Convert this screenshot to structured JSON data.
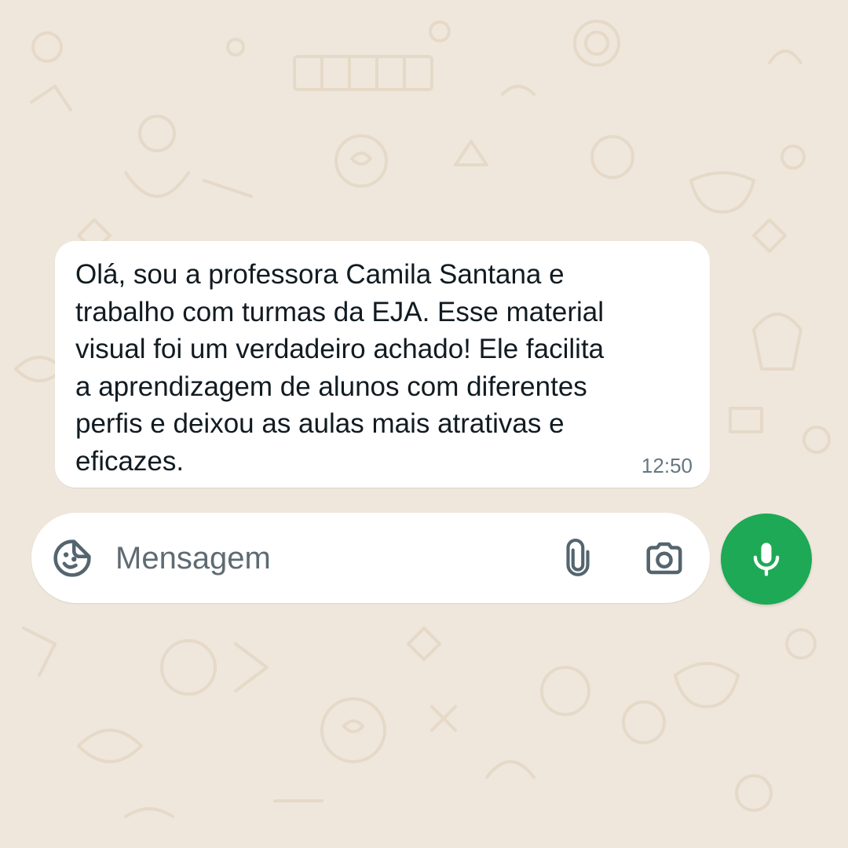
{
  "colors": {
    "chat_background": "#efe7dc",
    "bubble_background": "#ffffff",
    "message_text": "#111b21",
    "timestamp_text": "#667781",
    "placeholder_text": "#5f6b73",
    "icon_color": "#54656f",
    "mic_button": "#1da955"
  },
  "message": {
    "text": "Olá, sou a professora Camila Santana e\ntrabalho com turmas da EJA. Esse material\nvisual foi um verdadeiro achado! Ele facilita\na aprendizagem de alunos com diferentes\nperfis e deixou as aulas mais atrativas e\neficazes.",
    "time": "12:50"
  },
  "composer": {
    "placeholder": "Mensagem",
    "icons": {
      "sticker": "sticker-icon",
      "attach": "paperclip-icon",
      "camera": "camera-icon",
      "mic": "microphone-icon"
    }
  }
}
